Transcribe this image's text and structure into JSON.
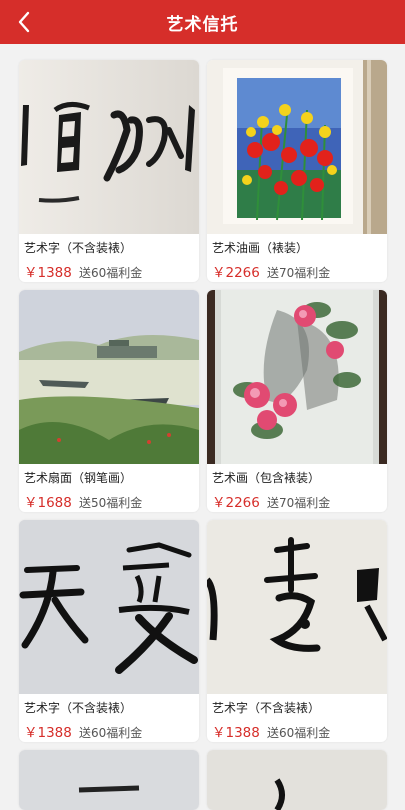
{
  "header": {
    "title": "艺术信托"
  },
  "products": [
    {
      "name": "艺术字（不含装裱）",
      "price": "￥1388",
      "bonus": "送60福利金",
      "image": "calligraphy-bai-yun"
    },
    {
      "name": "艺术油画（裱装）",
      "price": "￥2266",
      "bonus": "送70福利金",
      "image": "oil-painting-poppies"
    },
    {
      "name": "艺术扇面（钢笔画）",
      "price": "￥1688",
      "bonus": "送50福利金",
      "image": "fan-painting-river"
    },
    {
      "name": "艺术画（包含裱装）",
      "price": "￥2266",
      "bonus": "送70福利金",
      "image": "ink-painting-peony"
    },
    {
      "name": "艺术字（不含装裱）",
      "price": "￥1388",
      "bonus": "送60福利金",
      "image": "calligraphy-tian-ai"
    },
    {
      "name": "艺术字（不含装裱）",
      "price": "￥1388",
      "bonus": "送60福利金",
      "image": "calligraphy-zhi"
    }
  ],
  "colors": {
    "brand": "#d62e2a",
    "page_bg": "#f2f2f2"
  }
}
